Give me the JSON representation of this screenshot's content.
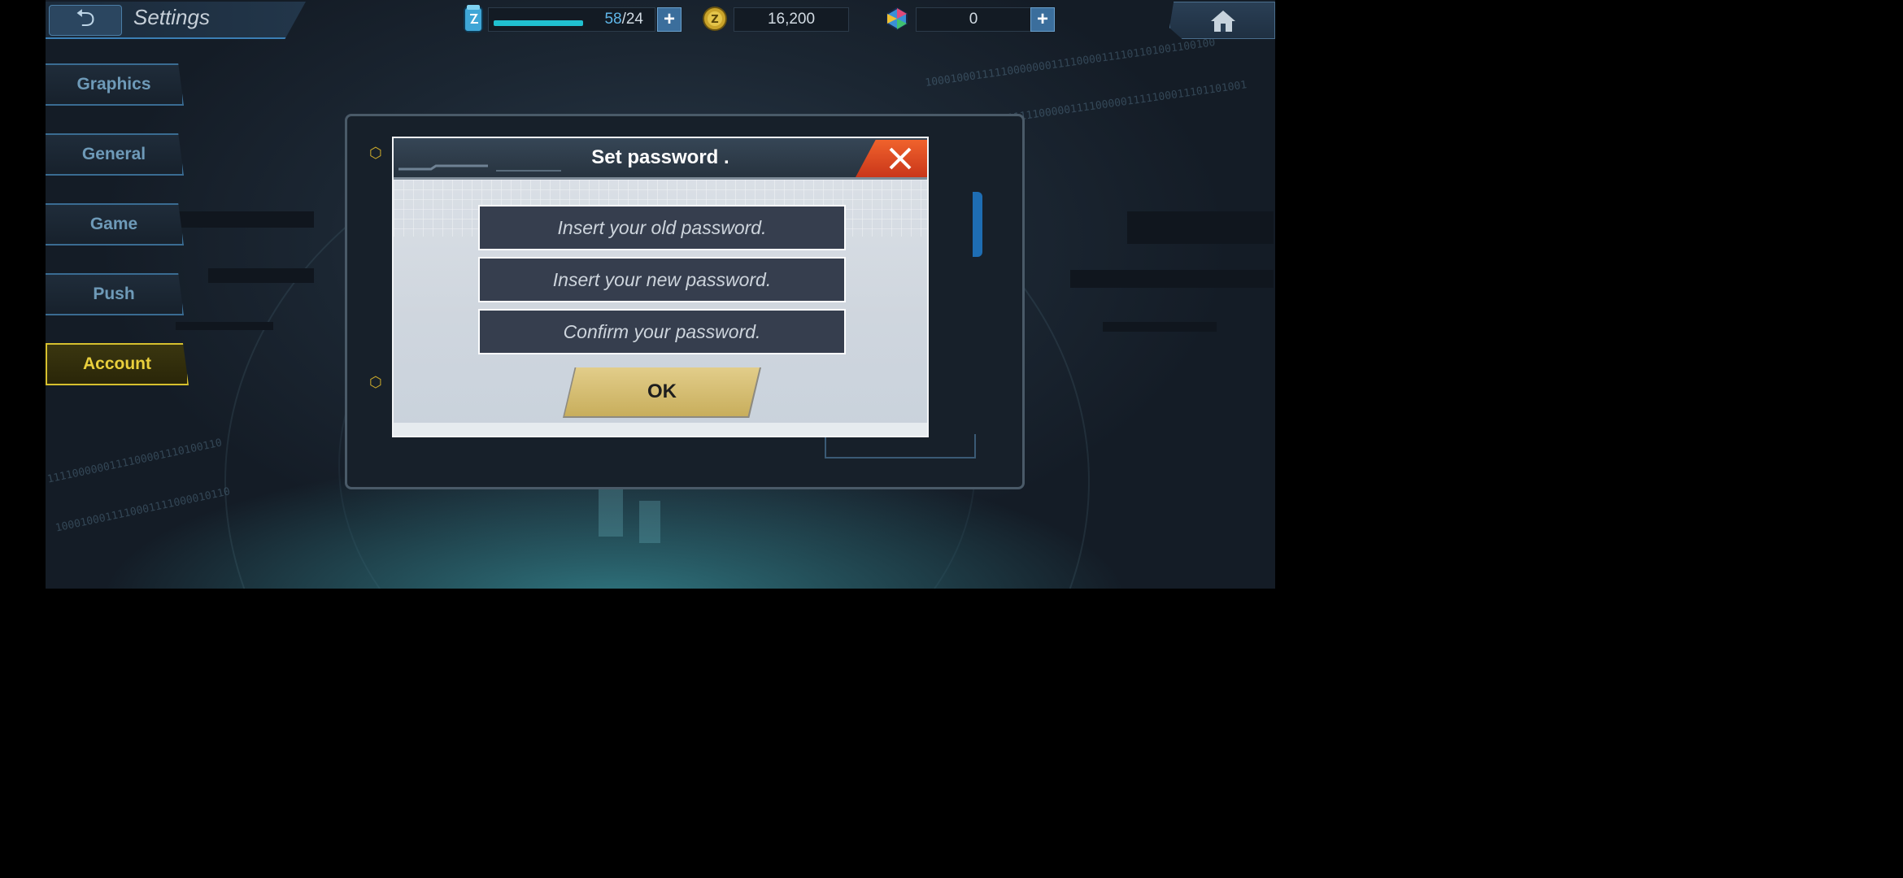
{
  "topbar": {
    "title": "Settings",
    "energy_current": "58",
    "energy_max": "/24",
    "coins": "16,200",
    "gems": "0"
  },
  "nav": {
    "items": [
      {
        "label": "Graphics"
      },
      {
        "label": "General"
      },
      {
        "label": "Game"
      },
      {
        "label": "Push"
      },
      {
        "label": "Account"
      }
    ],
    "active": "Account"
  },
  "modal": {
    "title": "Set password .",
    "fields": [
      {
        "placeholder": "Insert your old password."
      },
      {
        "placeholder": "Insert your new password."
      },
      {
        "placeholder": "Confirm your password."
      }
    ],
    "ok_label": "OK"
  },
  "colors": {
    "accent_blue": "#3b7fb5",
    "active_yellow": "#e9cf3c",
    "close_red": "#e0482a",
    "ok_gold": "#d6bf74"
  },
  "icons": [
    "back-arrow-icon",
    "energy-can-icon",
    "zeni-coin-icon",
    "gem-icon",
    "plus-icon",
    "home-icon",
    "close-icon",
    "hex-bullet-icon"
  ]
}
